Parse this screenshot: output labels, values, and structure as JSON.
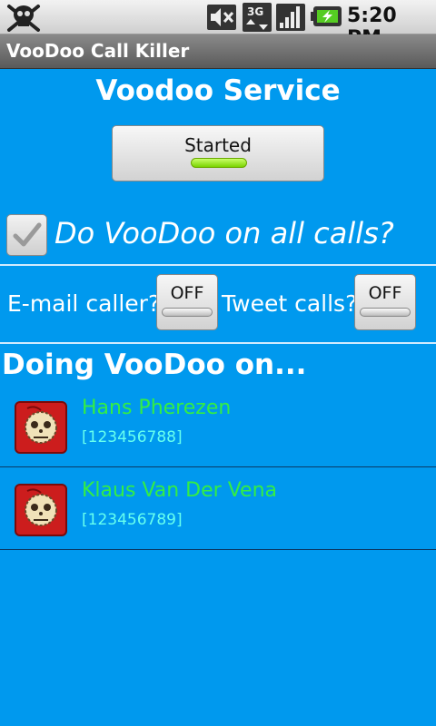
{
  "status_bar": {
    "time": "5:20 PM",
    "icons": [
      "skull-icon",
      "mute-icon",
      "3g-data-icon",
      "signal-icon",
      "battery-charging-icon"
    ],
    "network_label": "3G"
  },
  "app": {
    "title": "VooDoo Call Killer"
  },
  "service": {
    "heading": "Voodoo Service",
    "button_label": "Started",
    "indicator_color": "#7ad400"
  },
  "options": {
    "all_calls_label": "Do VooDoo on all calls?",
    "all_calls_checked": true,
    "email_label": "E-mail caller?",
    "email_toggle": "OFF",
    "tweet_label": "Tweet calls?",
    "tweet_toggle": "OFF"
  },
  "list": {
    "title": "Doing VooDoo on...",
    "contacts": [
      {
        "name": "Hans Pherezen",
        "number": "[123456788]"
      },
      {
        "name": "Klaus Van Der Vena",
        "number": "[123456789]"
      }
    ]
  },
  "colors": {
    "background": "#0099ee",
    "contact_name": "#33ee44",
    "contact_number": "#66ffee"
  }
}
